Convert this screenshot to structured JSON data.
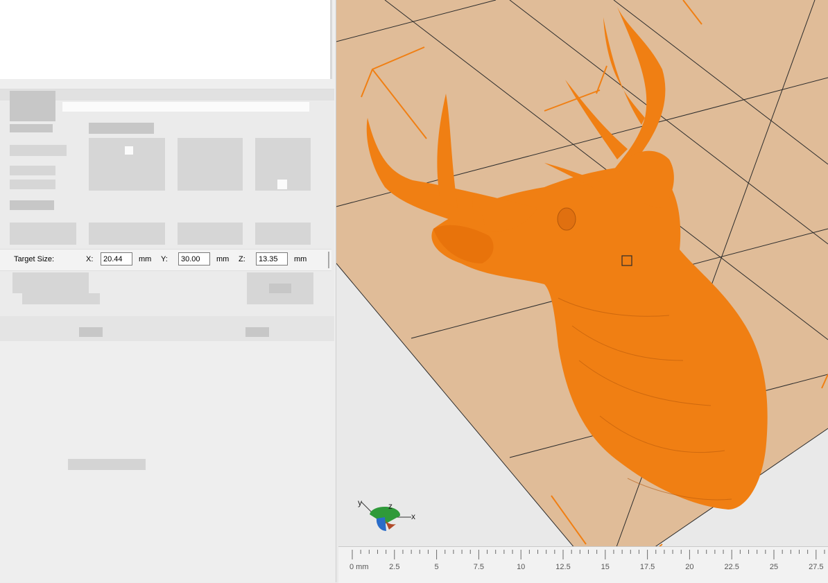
{
  "target_size": {
    "label": "Target Size:",
    "x_label": "X:",
    "x_value": "20.44",
    "y_label": "Y:",
    "y_value": "30.00",
    "z_label": "Z:",
    "z_value": "13.35",
    "unit": "mm"
  },
  "viewport": {
    "axis_labels": {
      "y": "y",
      "z": "z",
      "x": "x"
    }
  },
  "ruler": {
    "ticks": [
      "0 mm",
      "2.5",
      "5",
      "7.5",
      "10",
      "12.5",
      "15",
      "17.5",
      "20",
      "22.5",
      "25",
      "27.5"
    ]
  },
  "colors": {
    "model": "#f07f13",
    "bed": "#e0bc98",
    "grid_line": "#2b2b2b",
    "accent_line": "#f07f13"
  }
}
